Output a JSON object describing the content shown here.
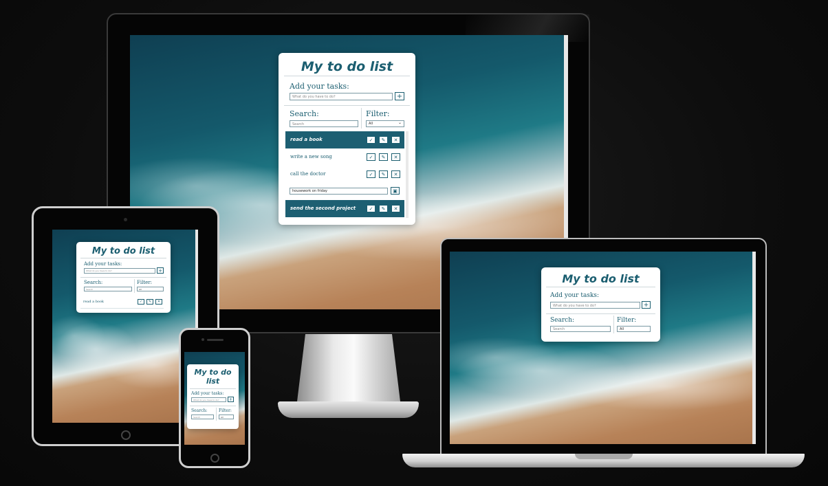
{
  "app": {
    "title": "My to do list",
    "title_small_line1": "My to do",
    "title_small_line2": "list",
    "add_label": "Add your tasks:",
    "add_placeholder": "What do you have to do?",
    "add_button": "+",
    "search_label": "Search:",
    "search_placeholder": "Search",
    "filter_label": "Filter:",
    "filter_value": "All",
    "select_chevron": "⌄"
  },
  "tasks": [
    {
      "text": "read a book",
      "done": true,
      "editing": false
    },
    {
      "text": "write a new song",
      "done": false,
      "editing": false
    },
    {
      "text": "call the doctor",
      "done": false,
      "editing": false
    },
    {
      "text": "housework on friday",
      "done": false,
      "editing": true
    },
    {
      "text": "send the second project",
      "done": true,
      "editing": false
    }
  ],
  "icons": {
    "check": "✓",
    "edit": "✎",
    "delete": "✕",
    "save": "▣"
  },
  "colors": {
    "accent": "#1b5e70",
    "done_row": "#1d5f72",
    "background": "#0d0d0d"
  }
}
